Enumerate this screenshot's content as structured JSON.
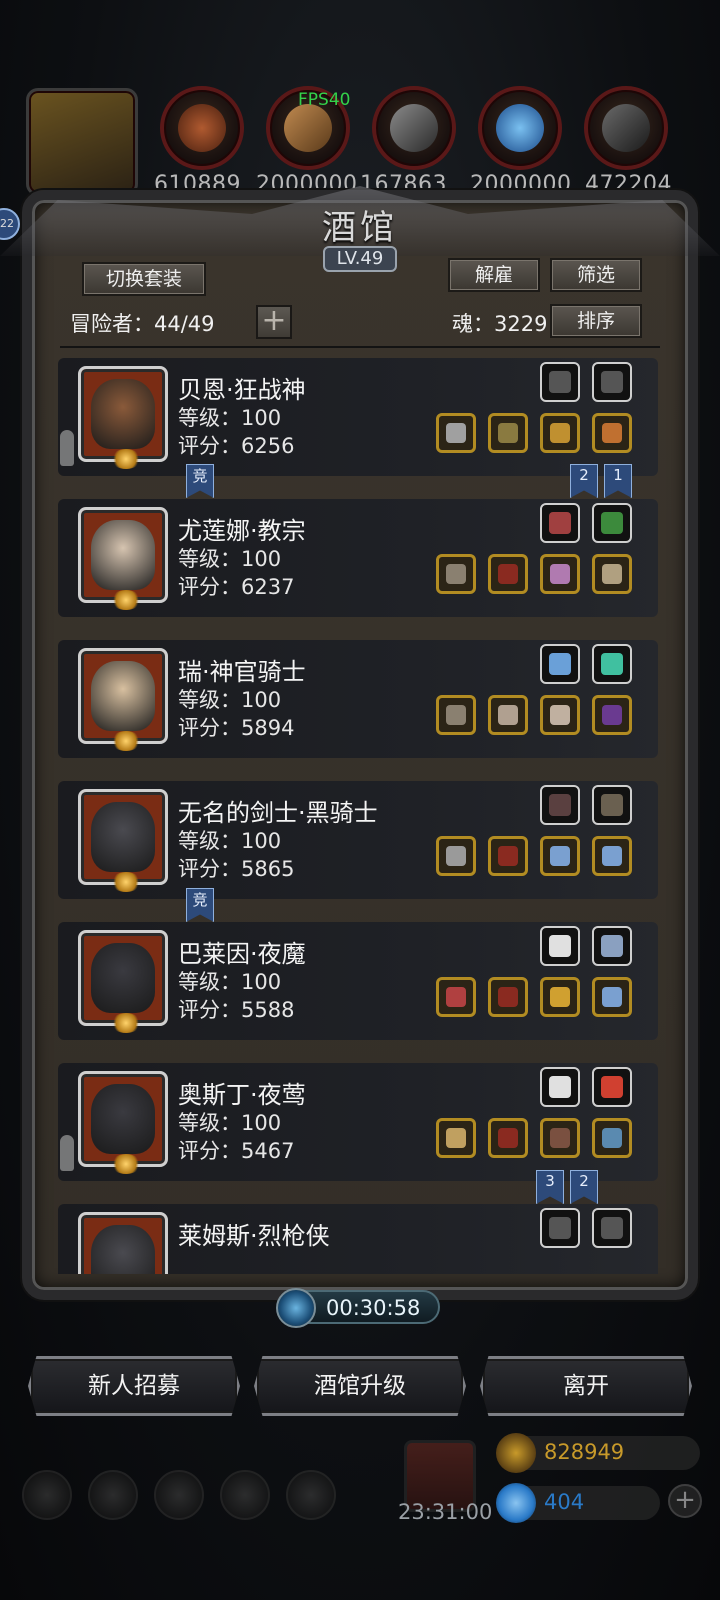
{
  "status": {
    "fps": "FPS40"
  },
  "resources": [
    {
      "name": "hero-portrait",
      "value": ""
    },
    {
      "name": "meat-icon",
      "value": "610889"
    },
    {
      "name": "wood-icon",
      "value": "2000000"
    },
    {
      "name": "iron-icon",
      "value": "167863"
    },
    {
      "name": "crystal-icon",
      "value": "2000000"
    },
    {
      "name": "ore-icon",
      "value": "472204"
    }
  ],
  "side_badge": "22",
  "tavern": {
    "title": "酒馆",
    "level": "LV.49",
    "switch_outfit_label": "切换套装",
    "dismiss_label": "解雇",
    "filter_label": "筛选",
    "sort_label": "排序",
    "adventurers_label": "冒险者：44/49",
    "souls_label": "魂：3229",
    "add_label": "+"
  },
  "heroes": [
    {
      "name": "贝恩·狂战神",
      "level": "等级：100",
      "score": "评分：6256",
      "ghost": true,
      "face_color": "#8a5a3a",
      "top_slots": [
        "#555",
        "#555"
      ],
      "bottom_slots": [
        "#a0a0a0",
        "#8a7a40",
        "#c09030",
        "#c07030"
      ]
    },
    {
      "name": "尤莲娜·教宗",
      "level": "等级：100",
      "score": "评分：6237",
      "ghost": false,
      "face_color": "#d6c4b0",
      "top_slots": [
        "#a04040",
        "#3c8a3c"
      ],
      "bottom_slots": [
        "#8a8070",
        "#8a2a20",
        "#b07ab0",
        "#b0a080"
      ]
    },
    {
      "name": "瑞·神官骑士",
      "level": "等级：100",
      "score": "评分：5894",
      "ghost": false,
      "face_color": "#d8c0a0",
      "top_slots": [
        "#6aa0d8",
        "#40c0a0"
      ],
      "bottom_slots": [
        "#8a8070",
        "#b0a090",
        "#c0b0a0",
        "#6a3a90"
      ]
    },
    {
      "name": "无名的剑士·黑骑士",
      "level": "等级：100",
      "score": "评分：5865",
      "ghost": false,
      "face_color": "#4a4a50",
      "top_slots": [
        "#5a4040",
        "#6a6050"
      ],
      "bottom_slots": [
        "#9a9a9a",
        "#8a2a20",
        "#7aa0d0",
        "#7aa0d0"
      ]
    },
    {
      "name": "巴莱因·夜魔",
      "level": "等级：100",
      "score": "评分：5588",
      "ghost": false,
      "face_color": "#3a3a40",
      "top_slots": [
        "#e0e0e0",
        "#8aa0c0"
      ],
      "bottom_slots": [
        "#b04040",
        "#8a2a20",
        "#d0a030",
        "#7aa0d0"
      ]
    },
    {
      "name": "奥斯丁·夜莺",
      "level": "等级：100",
      "score": "评分：5467",
      "ghost": true,
      "face_color": "#3a3a40",
      "top_slots": [
        "#e0e0e0",
        "#d04030"
      ],
      "bottom_slots": [
        "#c0a060",
        "#8a2a20",
        "#7a5040",
        "#5a8ab0"
      ]
    },
    {
      "name": "莱姆斯·烈枪侠",
      "level": "",
      "score": "",
      "ghost": false,
      "face_color": "#4a4a50",
      "top_slots": [
        "#555",
        "#555"
      ],
      "bottom_slots": []
    }
  ],
  "ranks": {
    "card0_left": "竞",
    "card0_r1": "2",
    "card0_r2": "1",
    "card3_left": "竞",
    "card5_r1": "3",
    "card5_r2": "2"
  },
  "timer": "00:30:58",
  "actions": {
    "recruit_label": "新人招募",
    "upgrade_label": "酒馆升级",
    "leave_label": "离开"
  },
  "hud": {
    "gift_timer": "23:31:00",
    "gold_value": "828949",
    "gem_value": "404",
    "gold_color": "#c89a2a",
    "gem_color": "#2a7ac8"
  }
}
